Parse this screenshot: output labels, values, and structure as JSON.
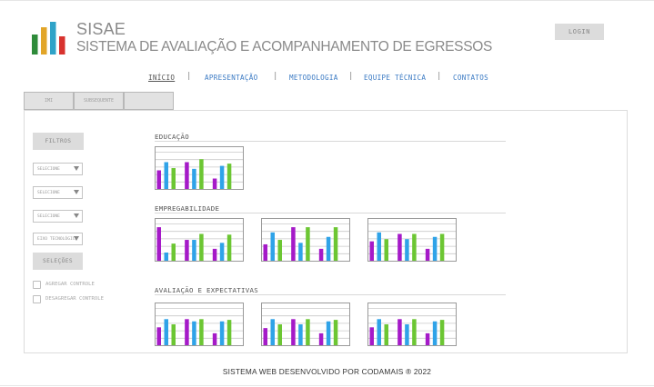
{
  "header": {
    "title": "SISAE",
    "subtitle": "SISTEMA DE AVALIAÇÃO E ACOMPANHAMENTO DE EGRESSOS",
    "login_label": "LOGIN",
    "logo_colors": [
      "#2e8b3a",
      "#e2a528",
      "#2fa3c8",
      "#d8322e"
    ]
  },
  "nav": {
    "items": [
      {
        "label": "INÍCIO",
        "active": true
      },
      {
        "label": "APRESENTAÇÃO",
        "active": false
      },
      {
        "label": "METODOLOGIA",
        "active": false
      },
      {
        "label": "EQUIPE TÉCNICA",
        "active": false
      },
      {
        "label": "CONTATOS",
        "active": false
      }
    ],
    "separator": "|"
  },
  "tabs": [
    "IMI",
    "SUBSEQUENTE",
    ""
  ],
  "sidebar": {
    "filters_label": "FILTROS",
    "selects": [
      {
        "label": "SELECIONE"
      },
      {
        "label": "SELECIONE"
      },
      {
        "label": "SELECIONE"
      },
      {
        "label": "EIXO TECNOLÓGICO"
      }
    ],
    "selections_label": "SELEÇÕES",
    "checkboxes": [
      {
        "label": "AGREGAR CONTROLE"
      },
      {
        "label": "DESAGREGAR CONTROLE"
      }
    ]
  },
  "sections": [
    {
      "title": "EDUCAÇÃO"
    },
    {
      "title": "EMPREGABILIDADE"
    },
    {
      "title": "AVALIAÇÃO E EXPECTATIVAS"
    }
  ],
  "series_colors": [
    "#a51ac8",
    "#2fa3e8",
    "#6cc633"
  ],
  "chart_data": [
    {
      "type": "bar",
      "section": "EDUCAÇÃO",
      "categories": [
        "",
        "",
        ""
      ],
      "ylim": [
        0,
        5
      ],
      "series": [
        {
          "values": [
            2.5,
            3.6,
            1.4
          ]
        },
        {
          "values": [
            3.6,
            2.7,
            3.1
          ]
        },
        {
          "values": [
            2.8,
            4.0,
            3.4
          ]
        }
      ]
    },
    {
      "type": "bar",
      "section": "EMPREGABILIDADE",
      "categories": [
        "",
        "",
        ""
      ],
      "ylim": [
        0,
        5
      ],
      "series": [
        {
          "values": [
            4.5,
            2.8,
            1.6
          ]
        },
        {
          "values": [
            1.1,
            2.8,
            2.4
          ]
        },
        {
          "values": [
            2.3,
            3.6,
            3.5
          ]
        }
      ]
    },
    {
      "type": "bar",
      "section": "EMPREGABILIDADE",
      "categories": [
        "",
        "",
        ""
      ],
      "ylim": [
        0,
        5
      ],
      "series": [
        {
          "values": [
            2.2,
            4.5,
            1.6
          ]
        },
        {
          "values": [
            3.8,
            2.4,
            3.2
          ]
        },
        {
          "values": [
            2.8,
            4.5,
            4.5
          ]
        }
      ]
    },
    {
      "type": "bar",
      "section": "EMPREGABILIDADE",
      "categories": [
        "",
        "",
        ""
      ],
      "ylim": [
        0,
        5
      ],
      "series": [
        {
          "values": [
            2.6,
            3.6,
            1.6
          ]
        },
        {
          "values": [
            3.8,
            2.9,
            3.2
          ]
        },
        {
          "values": [
            2.9,
            3.6,
            3.6
          ]
        }
      ]
    },
    {
      "type": "bar",
      "section": "AVALIAÇÃO E EXPECTATIVAS",
      "categories": [
        "",
        "",
        ""
      ],
      "ylim": [
        0,
        5
      ],
      "series": [
        {
          "values": [
            2.4,
            3.5,
            1.6
          ]
        },
        {
          "values": [
            3.5,
            3.2,
            3.2
          ]
        },
        {
          "values": [
            2.8,
            3.5,
            3.4
          ]
        }
      ]
    },
    {
      "type": "bar",
      "section": "AVALIAÇÃO E EXPECTATIVAS",
      "categories": [
        "",
        "",
        ""
      ],
      "ylim": [
        0,
        5
      ],
      "series": [
        {
          "values": [
            2.3,
            3.5,
            1.6
          ]
        },
        {
          "values": [
            3.5,
            2.8,
            3.2
          ]
        },
        {
          "values": [
            2.8,
            3.5,
            3.4
          ]
        }
      ]
    },
    {
      "type": "bar",
      "section": "AVALIAÇÃO E EXPECTATIVAS",
      "categories": [
        "",
        "",
        ""
      ],
      "ylim": [
        0,
        5
      ],
      "series": [
        {
          "values": [
            2.4,
            3.5,
            1.6
          ]
        },
        {
          "values": [
            3.5,
            2.8,
            3.2
          ]
        },
        {
          "values": [
            2.8,
            3.5,
            3.4
          ]
        }
      ]
    }
  ],
  "footer": {
    "text": "SISTEMA WEB DESENVOLVIDO POR CODAMAIS ® 2022"
  }
}
